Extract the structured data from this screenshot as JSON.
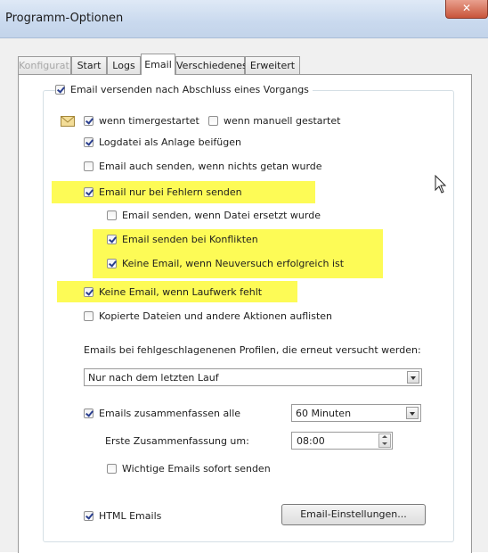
{
  "window": {
    "title": "Programm-Optionen",
    "close_glyph": "✕"
  },
  "tabs": [
    {
      "label": "Konfiguration",
      "state": "disabled"
    },
    {
      "label": "Start",
      "state": "normal"
    },
    {
      "label": "Logs",
      "state": "normal"
    },
    {
      "label": "Email",
      "state": "active"
    },
    {
      "label": "Verschiedenes",
      "state": "normal"
    },
    {
      "label": "Erweitert",
      "state": "normal"
    }
  ],
  "group": {
    "label": "Email versenden nach Abschluss eines Vorgangs",
    "checked": true
  },
  "options": {
    "timer": {
      "label": "wenn timergestartet",
      "checked": true
    },
    "manual": {
      "label": "wenn manuell gestartet",
      "checked": false
    },
    "attach_log": {
      "label": "Logdatei als Anlage beifügen",
      "checked": true
    },
    "send_if_nothing": {
      "label": "Email auch senden, wenn nichts getan wurde",
      "checked": false
    },
    "only_errors": {
      "label": "Email nur bei Fehlern senden",
      "checked": true
    },
    "file_replaced": {
      "label": "Email senden, wenn Datei ersetzt wurde",
      "checked": false
    },
    "conflicts": {
      "label": "Email senden bei Konflikten",
      "checked": true
    },
    "retry_success": {
      "label": "Keine Email, wenn Neuversuch erfolgreich ist",
      "checked": true
    },
    "drive_missing": {
      "label": "Keine Email, wenn Laufwerk fehlt",
      "checked": true
    },
    "list_copied": {
      "label": "Kopierte Dateien und andere Aktionen auflisten",
      "checked": false
    }
  },
  "failed_profiles": {
    "label": "Emails bei fehlgeschlagenenen Profilen, die erneut versucht werden:",
    "selected": "Nur nach dem letzten Lauf"
  },
  "summarize": {
    "label": "Emails zusammenfassen alle",
    "checked": true,
    "interval": "60 Minuten"
  },
  "first_summary": {
    "label": "Erste Zusammenfassung um:",
    "time": "08:00"
  },
  "important_now": {
    "label": "Wichtige Emails sofort senden",
    "checked": false
  },
  "html_emails": {
    "label": "HTML Emails",
    "checked": true
  },
  "settings_button": {
    "label": "Email-Einstellungen..."
  },
  "colors": {
    "highlight": "#fdfb56",
    "checkmark": "#2a3f8f"
  },
  "icons": {
    "envelope": "envelope-icon",
    "cursor": "mouse-pointer-icon"
  }
}
